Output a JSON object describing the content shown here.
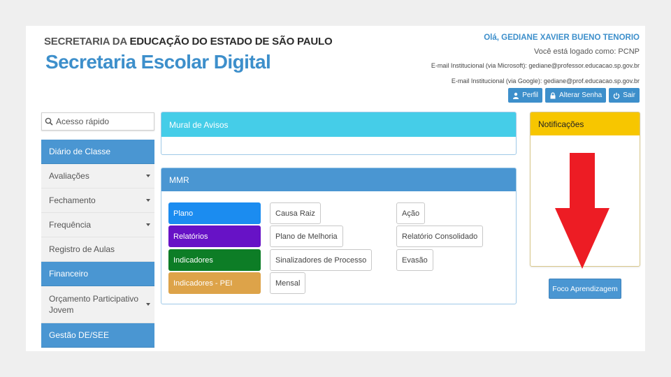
{
  "header": {
    "org_prefix": "SECRETARIA DA",
    "org_strong": "EDUCAÇÃO DO ESTADO DE SÃO PAULO",
    "app_title": "Secretaria Escolar Digital"
  },
  "user": {
    "greeting": "Olá, GEDIANE XAVIER BUENO TENORIO",
    "logged_as": "Você está logado como: PCNP",
    "email_microsoft": "E-mail Institucional (via Microsoft): gediane@professor.educacao.sp.gov.br",
    "email_google": "E-mail Institucional (via Google): gediane@prof.educacao.sp.gov.br",
    "actions": {
      "profile": "Perfil",
      "change_password": "Alterar Senha",
      "logout": "Sair"
    }
  },
  "search": {
    "placeholder": "Acesso rápido"
  },
  "sidebar": {
    "items": [
      {
        "label": "Diário de Classe",
        "active": true,
        "caret": false
      },
      {
        "label": "Avaliações",
        "active": false,
        "caret": true
      },
      {
        "label": "Fechamento",
        "active": false,
        "caret": true
      },
      {
        "label": "Frequência",
        "active": false,
        "caret": true
      },
      {
        "label": "Registro de Aulas",
        "active": false,
        "caret": false
      },
      {
        "label": "Financeiro",
        "active": true,
        "caret": false
      },
      {
        "label": "Orçamento Participativo Jovem",
        "active": false,
        "caret": true
      },
      {
        "label": "Gestão DE/SEE",
        "active": true,
        "caret": false
      }
    ]
  },
  "mural": {
    "title": "Mural de Avisos"
  },
  "mmr": {
    "title": "MMR",
    "solid_buttons": [
      "Plano",
      "Relatórios",
      "Indicadores",
      "Indicadores - PEI"
    ],
    "outline_buttons": [
      "Causa Raiz",
      "Plano de Melhoria",
      "Sinalizadores de Processo",
      "Mensal",
      "Ação",
      "Relatório Consolidado",
      "Evasão"
    ]
  },
  "notifications": {
    "title": "Notificações",
    "focus_button": "Foco Aprendizagem"
  },
  "colors": {
    "primary": "#4a96d2",
    "mural_header": "#45cde8",
    "notification_header": "#f7c600",
    "plano": "#1b8cf0",
    "relatorios": "#6712c6",
    "indicadores": "#0d7d26",
    "indicadores_pei": "#dda349",
    "arrow": "#ed1c24"
  }
}
